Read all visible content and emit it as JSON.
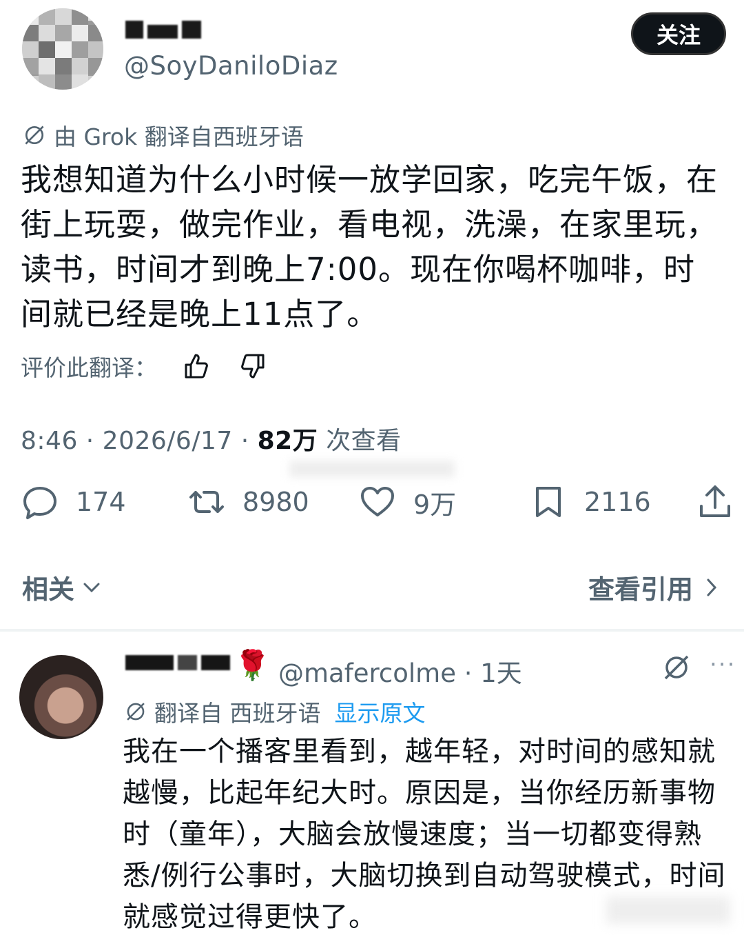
{
  "post": {
    "handle": "@SoyDaniloDiaz",
    "follow_label": "关注",
    "translated_by": "由 Grok 翻译自西班牙语",
    "text": "我想知道为什么小时候一放学回家，吃完午饭，在街上玩耍，做完作业，看电视，洗澡，在家里玩，读书，时间才到晚上7:00。现在你喝杯咖啡，时间就已经是晚上11点了。",
    "rate_label": "评价此翻译：",
    "time": "8:46 · 2026/6/17 · ",
    "views": "82万",
    "views_suffix": " 次查看",
    "replies": "174",
    "reposts": "8980",
    "likes": "9万",
    "bookmarks": "2116"
  },
  "nav": {
    "related": "相关",
    "quotes": "查看引用"
  },
  "reply": {
    "handle_time": "@mafercolme · 1天",
    "more": "···",
    "translated_from": "翻译自 西班牙语",
    "show_original": "显示原文",
    "text": "我在一个播客里看到，越年轻，对时间的感知就越慢，比起年纪大时。原因是，当你经历新事物时（童年），大脑会放慢速度；当一切都变得熟悉/例行公事时，大脑切换到自动驾驶模式，时间就感觉过得更快了。"
  },
  "icons": {
    "grok": "grok-icon",
    "thumbs_up": "thumbs-up-icon",
    "thumbs_down": "thumbs-down-icon",
    "reply": "reply-icon",
    "repost": "repost-icon",
    "like": "heart-icon",
    "bookmark": "bookmark-icon",
    "share": "share-icon",
    "chevron_down": "chevron-down-icon",
    "chevron_right": "chevron-right-icon",
    "rose": "rose-icon"
  },
  "colors": {
    "text": "#0f1419",
    "muted": "#536471",
    "link": "#1d9bf0",
    "button": "#0f1419"
  }
}
